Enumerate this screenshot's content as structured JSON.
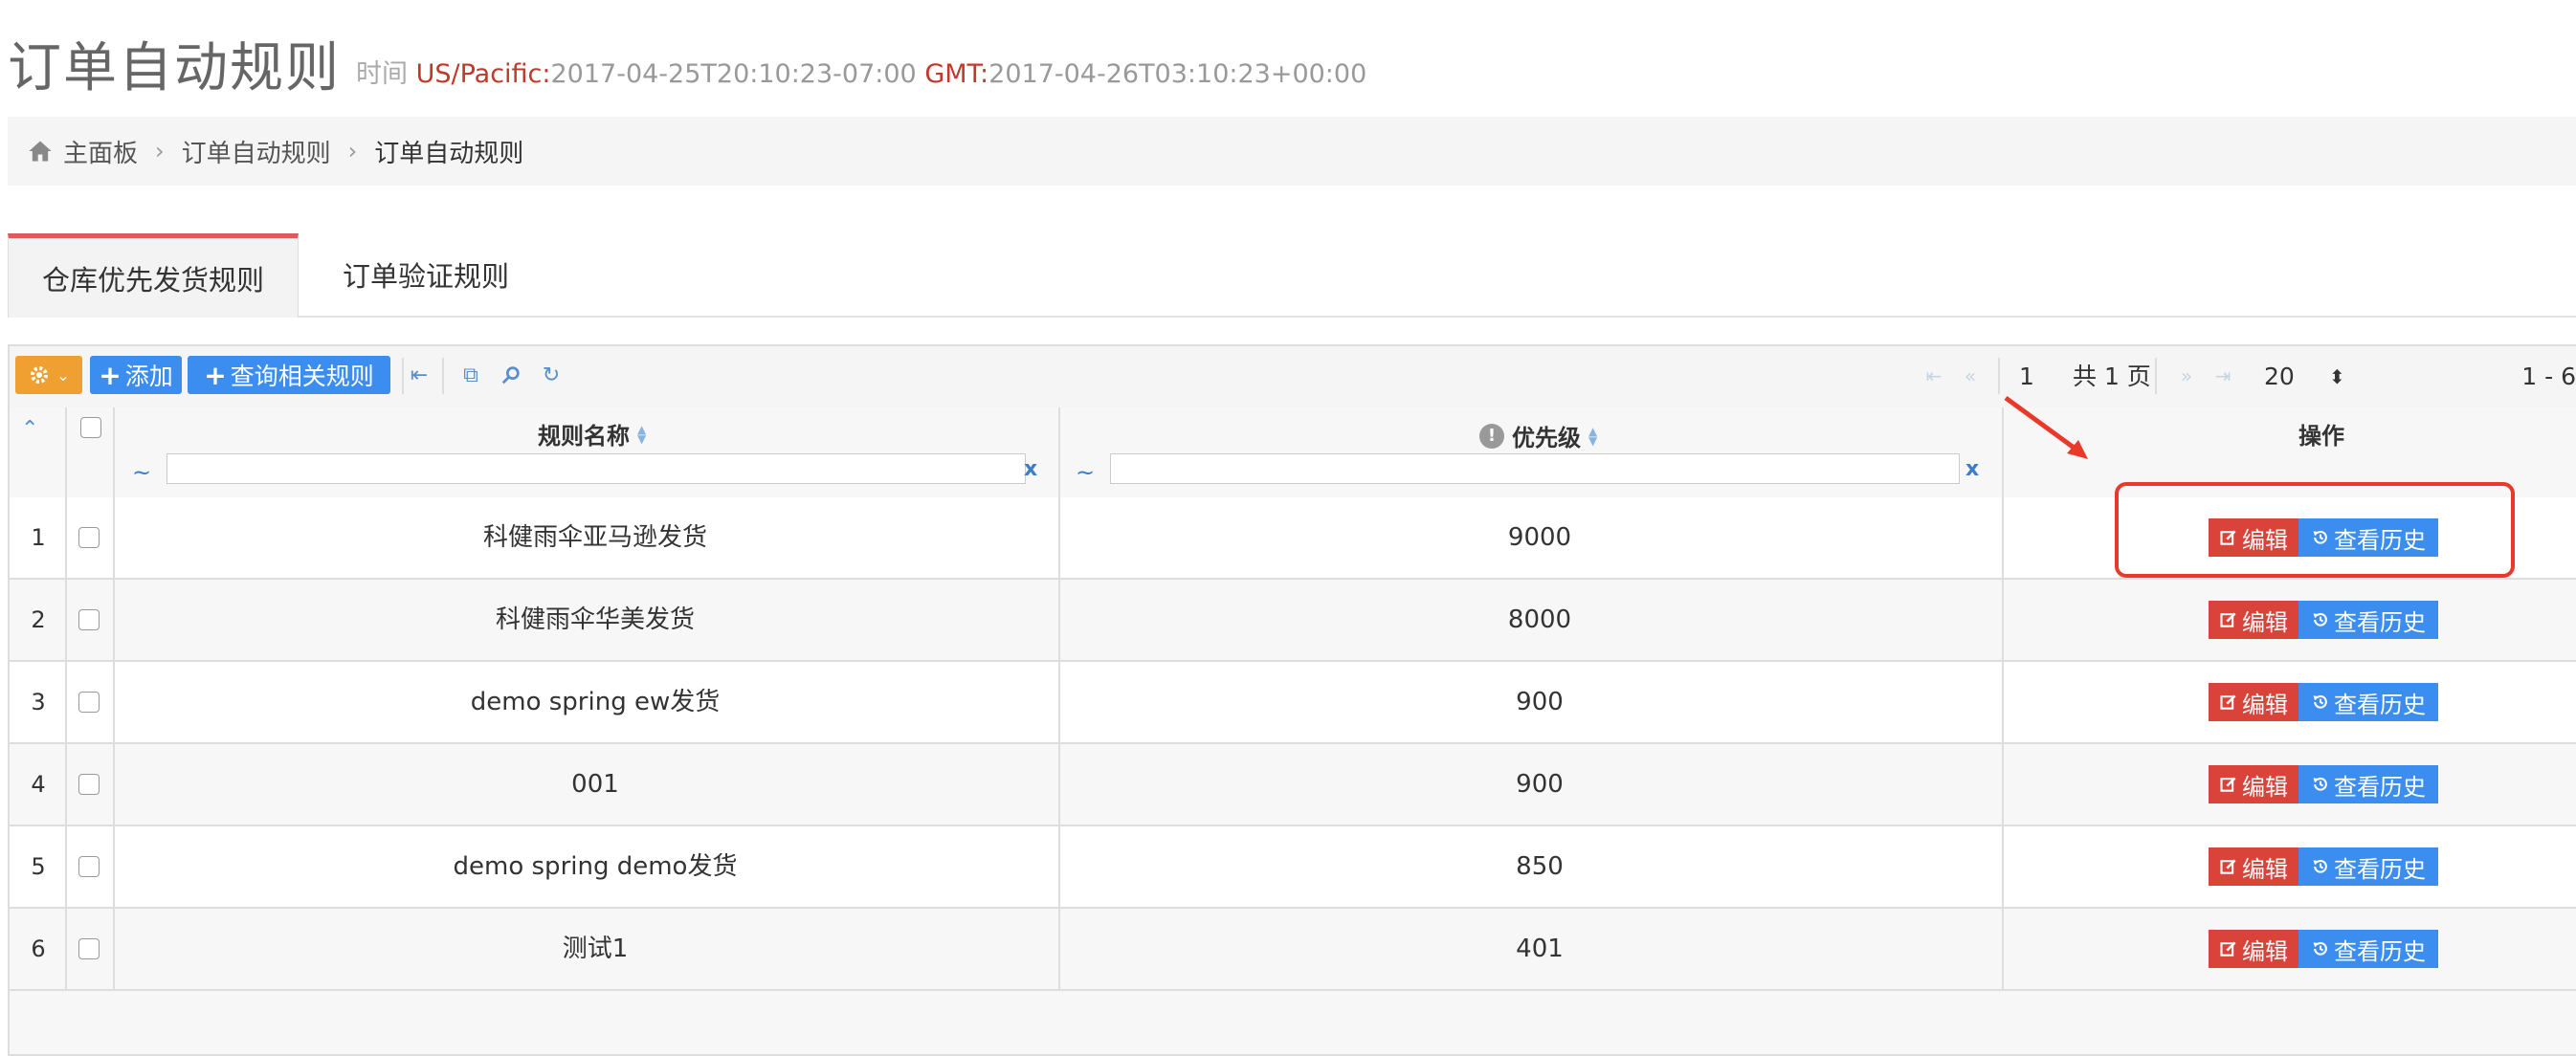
{
  "header": {
    "title": "订单自动规则",
    "time_label": "时间",
    "tz1_label": "US/Pacific:",
    "tz1_value": "2017-04-25T20:10:23-07:00",
    "tz2_label": "GMT:",
    "tz2_value": "2017-04-26T03:10:23+00:00"
  },
  "breadcrumb": {
    "home": "主面板",
    "item1": "订单自动规则",
    "current": "订单自动规则"
  },
  "tabs": [
    {
      "label": "仓库优先发货规则",
      "active": true
    },
    {
      "label": "订单验证规则",
      "active": false
    }
  ],
  "toolbar": {
    "add_label": "添加",
    "query_label": "查询相关规则",
    "page_current": "1",
    "page_total_text": "共 1 页",
    "page_size": "20",
    "range_text": "1 - 6"
  },
  "columns": {
    "name": "规则名称",
    "priority": "优先级",
    "actions": "操作",
    "filter_tilde": "~",
    "filter_clear": "x"
  },
  "actions": {
    "edit_label": "编辑",
    "history_label": "查看历史"
  },
  "rows": [
    {
      "num": "1",
      "name": "科健雨伞亚马逊发货",
      "priority": "9000"
    },
    {
      "num": "2",
      "name": "科健雨伞华美发货",
      "priority": "8000"
    },
    {
      "num": "3",
      "name": "demo spring ew发货",
      "priority": "900"
    },
    {
      "num": "4",
      "name": "001",
      "priority": "900"
    },
    {
      "num": "5",
      "name": "demo spring demo发货",
      "priority": "850"
    },
    {
      "num": "6",
      "name": "测试1",
      "priority": "401"
    }
  ],
  "colors": {
    "accent_red": "#d9433a",
    "accent_blue": "#3b8ef0",
    "gear_orange": "#f0a030",
    "annotation": "#e8392b"
  }
}
